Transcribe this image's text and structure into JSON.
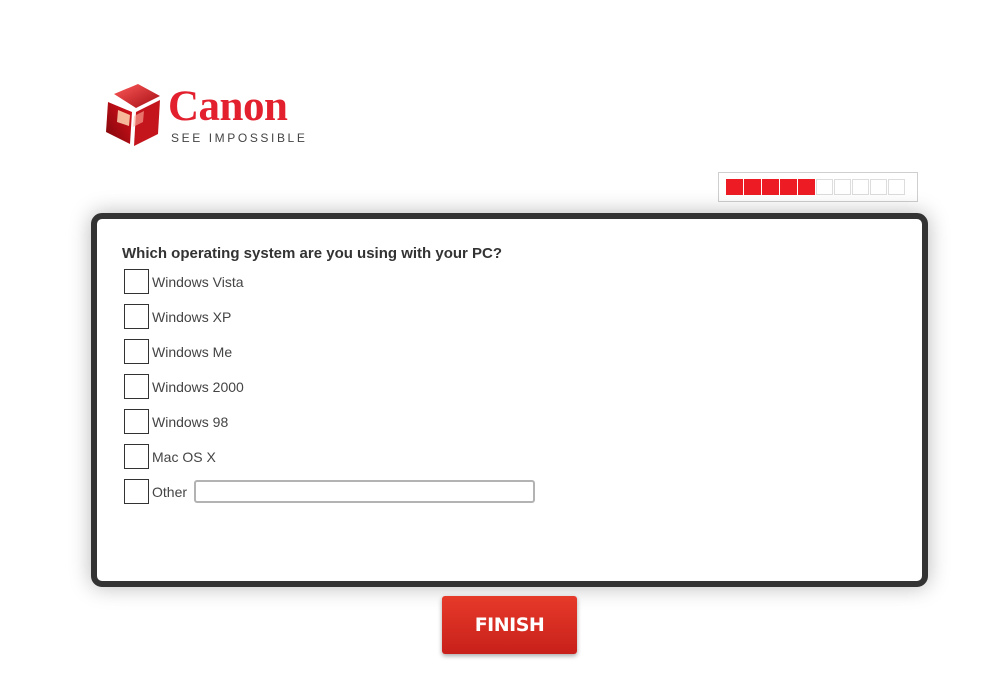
{
  "brand": {
    "name": "Canon",
    "tagline": "SEE IMPOSSIBLE",
    "color": "#e3202e"
  },
  "progress": {
    "filled": 5,
    "total": 10,
    "color": "#ed1c24"
  },
  "survey": {
    "question": "Which operating system are you using with your PC?",
    "options": [
      {
        "label": "Windows Vista",
        "checked": false
      },
      {
        "label": "Windows XP",
        "checked": false
      },
      {
        "label": "Windows Me",
        "checked": false
      },
      {
        "label": "Windows 2000",
        "checked": false
      },
      {
        "label": "Windows 98",
        "checked": false
      },
      {
        "label": "Mac OS X",
        "checked": false
      },
      {
        "label": "Other",
        "checked": false,
        "has_text_input": true,
        "text_value": ""
      }
    ]
  },
  "finish_button": {
    "label": "FINISH",
    "color": "#d42a1f"
  }
}
